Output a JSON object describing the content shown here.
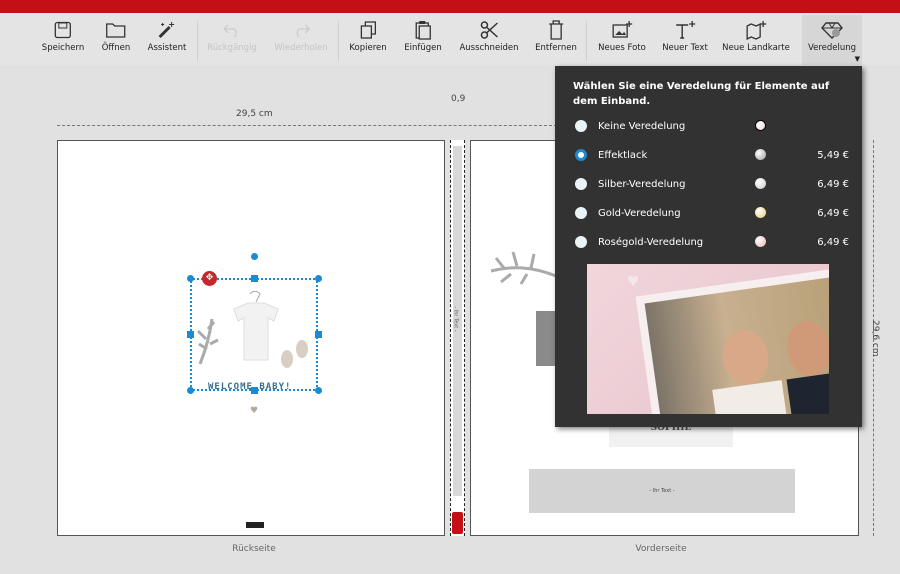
{
  "toolbar": {
    "save": "Speichern",
    "open": "Öffnen",
    "assistant": "Assistent",
    "undo": "Rückgängig",
    "redo": "Wiederholen",
    "copy": "Kopieren",
    "paste": "Einfügen",
    "cut": "Ausschneiden",
    "delete": "Entfernen",
    "new_photo": "Neues Foto",
    "new_text": "Neuer Text",
    "new_map": "Neue Landkarte",
    "finishing": "Veredelung"
  },
  "rulers": {
    "width": "29,5 cm",
    "spine": "0,9",
    "height": "29,6 cm"
  },
  "pages": {
    "back": "Rückseite",
    "front": "Vorderseite"
  },
  "back_cover": {
    "caption": "WELCOME BABY!"
  },
  "front_cover": {
    "name": "SOPHIE",
    "placeholder": "- Ihr Text -"
  },
  "spine": {
    "placeholder": "- Ihr Text -"
  },
  "popup": {
    "title": "Wählen Sie eine Veredelung für Elemente auf dem Einband.",
    "selected": "Effektlack",
    "options": [
      {
        "label": "Keine Veredelung",
        "price": "",
        "color": "#f0d0d8"
      },
      {
        "label": "Effektlack",
        "price": "5,49 €",
        "color": "#9a9a9a"
      },
      {
        "label": "Silber-Veredelung",
        "price": "6,49 €",
        "color": "#c8c8c8"
      },
      {
        "label": "Gold-Veredelung",
        "price": "6,49 €",
        "color": "#e8c870"
      },
      {
        "label": "Roségold-Veredelung",
        "price": "6,49 €",
        "color": "#e8b4a8"
      }
    ]
  }
}
